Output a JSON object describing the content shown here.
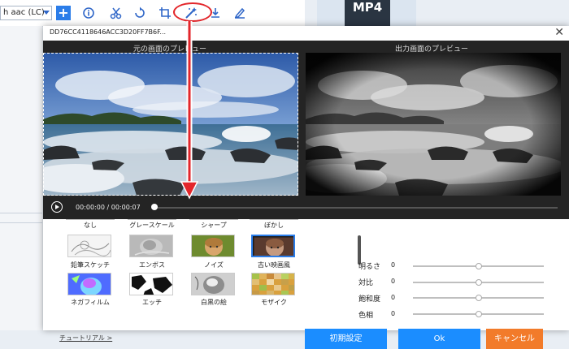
{
  "background": {
    "codec_label": "h aac (LC)",
    "add_label": "+",
    "mp4_label": "MP4"
  },
  "dialog": {
    "title": "DD76CC4118646ACC3D20FF7B6F...",
    "close_glyph": "✕",
    "original_caption": "元の画面のプレビュー",
    "output_caption": "出力画面のプレビュー",
    "time_current": "00:00:00",
    "time_separator": "/",
    "time_total": "00:00:07"
  },
  "effects": {
    "row1": [
      {
        "category": "なし",
        "label": "鉛筆スケッチ",
        "style": "pencil"
      },
      {
        "category": "グレースケール",
        "label": "エンボス",
        "style": "emboss"
      },
      {
        "category": "シャープ",
        "label": "ノイズ",
        "style": "noise"
      },
      {
        "category": "ぼかし",
        "label": "古い映画風",
        "style": "oldfilm"
      }
    ],
    "row2": [
      {
        "label": "ネガフィルム",
        "style": "negative"
      },
      {
        "label": "エッチ",
        "style": "etch"
      },
      {
        "label": "白黒の絵",
        "style": "bw"
      },
      {
        "label": "モザイク",
        "style": "mosaic"
      }
    ],
    "selected_index": 3
  },
  "adjustments": [
    {
      "label": "明るさ",
      "value": "0"
    },
    {
      "label": "対比",
      "value": "0"
    },
    {
      "label": "飽和度",
      "value": "0"
    },
    {
      "label": "色相",
      "value": "0"
    }
  ],
  "footer": {
    "tutorial": "チュートリアル >",
    "reset": "初期設定",
    "ok": "Ok",
    "cancel": "キャンセル"
  },
  "colors": {
    "accent": "#1b8dff",
    "cancel": "#f27b2a",
    "highlight": "#e3262b"
  }
}
